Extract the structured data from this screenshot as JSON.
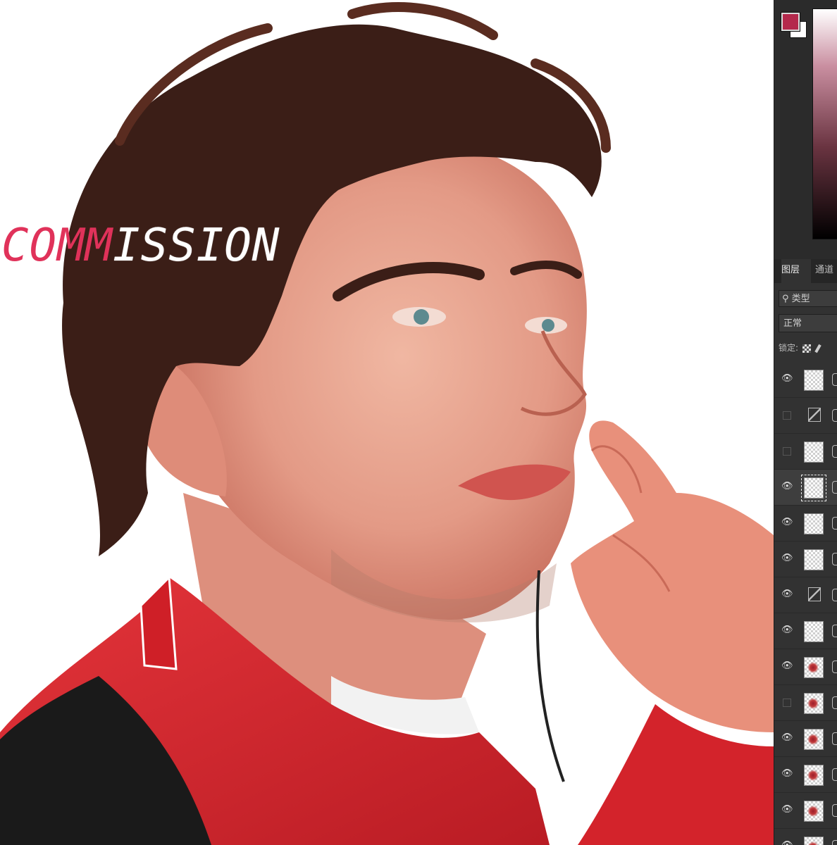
{
  "canvas": {
    "watermark_highlight": "COMM",
    "watermark_rest": "ISSION",
    "watermark_color": "#e0325a",
    "jacket_color": "#d8262c",
    "hair_color": "#3b1e17",
    "skin_color": "#e7a08c"
  },
  "color_panel": {
    "foreground": "#b4294c",
    "background": "#ffffff"
  },
  "layers_panel": {
    "tabs": [
      {
        "label": "图层",
        "active": true
      },
      {
        "label": "通道",
        "active": false
      }
    ],
    "filter_label": "类型",
    "blend_mode": "正常",
    "lock_label": "锁定:",
    "layers": [
      {
        "visible": true,
        "type": "pixel"
      },
      {
        "visible": false,
        "type": "adjustment"
      },
      {
        "visible": false,
        "type": "pixel"
      },
      {
        "visible": true,
        "type": "pixel",
        "selected": true
      },
      {
        "visible": true,
        "type": "pixel"
      },
      {
        "visible": true,
        "type": "pixel"
      },
      {
        "visible": true,
        "type": "adjustment"
      },
      {
        "visible": true,
        "type": "pixel"
      },
      {
        "visible": true,
        "type": "art"
      },
      {
        "visible": false,
        "type": "art"
      },
      {
        "visible": true,
        "type": "art"
      },
      {
        "visible": true,
        "type": "art"
      },
      {
        "visible": true,
        "type": "art"
      },
      {
        "visible": true,
        "type": "art"
      }
    ]
  }
}
